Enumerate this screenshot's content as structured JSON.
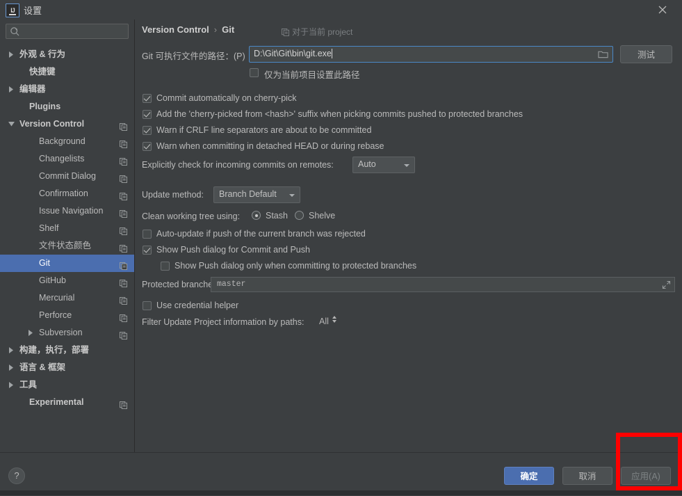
{
  "window": {
    "title": "设置",
    "logo_text": "IJ",
    "close_icon": "close-icon"
  },
  "sidebar": {
    "search": {
      "placeholder": "",
      "value": "",
      "icon": "search-icon"
    },
    "items": [
      {
        "label": "外观 & 行为",
        "arrow": "collapsed",
        "indent": 14,
        "bold": true,
        "copy": false,
        "selected": false
      },
      {
        "label": "快捷键",
        "arrow": "none",
        "indent": 28,
        "bold": true,
        "copy": false,
        "selected": false
      },
      {
        "label": "编辑器",
        "arrow": "collapsed",
        "indent": 14,
        "bold": true,
        "copy": false,
        "selected": false
      },
      {
        "label": "Plugins",
        "arrow": "none",
        "indent": 28,
        "bold": true,
        "copy": false,
        "selected": false
      },
      {
        "label": "Version Control",
        "arrow": "expanded",
        "indent": 14,
        "bold": true,
        "copy": true,
        "selected": false
      },
      {
        "label": "Background",
        "arrow": "none",
        "indent": 42,
        "bold": false,
        "copy": true,
        "selected": false
      },
      {
        "label": "Changelists",
        "arrow": "none",
        "indent": 42,
        "bold": false,
        "copy": true,
        "selected": false
      },
      {
        "label": "Commit Dialog",
        "arrow": "none",
        "indent": 42,
        "bold": false,
        "copy": true,
        "selected": false
      },
      {
        "label": "Confirmation",
        "arrow": "none",
        "indent": 42,
        "bold": false,
        "copy": true,
        "selected": false
      },
      {
        "label": "Issue Navigation",
        "arrow": "none",
        "indent": 42,
        "bold": false,
        "copy": true,
        "selected": false
      },
      {
        "label": "Shelf",
        "arrow": "none",
        "indent": 42,
        "bold": false,
        "copy": true,
        "selected": false
      },
      {
        "label": "文件状态颜色",
        "arrow": "none",
        "indent": 42,
        "bold": false,
        "copy": true,
        "selected": false
      },
      {
        "label": "Git",
        "arrow": "none",
        "indent": 42,
        "bold": false,
        "copy": true,
        "selected": true
      },
      {
        "label": "GitHub",
        "arrow": "none",
        "indent": 42,
        "bold": false,
        "copy": true,
        "selected": false
      },
      {
        "label": "Mercurial",
        "arrow": "none",
        "indent": 42,
        "bold": false,
        "copy": true,
        "selected": false
      },
      {
        "label": "Perforce",
        "arrow": "none",
        "indent": 42,
        "bold": false,
        "copy": true,
        "selected": false
      },
      {
        "label": "Subversion",
        "arrow": "collapsed",
        "indent": 42,
        "bold": false,
        "copy": true,
        "selected": false
      },
      {
        "label": "构建，执行，部署",
        "arrow": "collapsed",
        "indent": 14,
        "bold": true,
        "copy": false,
        "selected": false
      },
      {
        "label": "语言 & 框架",
        "arrow": "collapsed",
        "indent": 14,
        "bold": true,
        "copy": false,
        "selected": false
      },
      {
        "label": "工具",
        "arrow": "collapsed",
        "indent": 14,
        "bold": true,
        "copy": false,
        "selected": false
      },
      {
        "label": "Experimental",
        "arrow": "none",
        "indent": 28,
        "bold": true,
        "copy": true,
        "selected": false
      }
    ]
  },
  "main": {
    "breadcrumb_parent": "Version Control",
    "breadcrumb_sep": "›",
    "breadcrumb_current": "Git",
    "scope_label": "对于当前 project",
    "path_label": "Git 可执行文件的路径：(P)",
    "path_value": "D:\\Git\\Git\\bin\\git.exe",
    "browse_icon": "folder-icon",
    "test_button": "测试",
    "project_only_label": "仅为当前项目设置此路径",
    "project_only_checked": false,
    "checkboxes": [
      {
        "label": "Commit automatically on cherry-pick",
        "checked": true
      },
      {
        "label": "Add the 'cherry-picked from <hash>' suffix when picking commits pushed to protected branches",
        "checked": true
      },
      {
        "label": "Warn if CRLF line separators are about to be committed",
        "checked": true
      },
      {
        "label": "Warn when committing in detached HEAD or during rebase",
        "checked": true
      }
    ],
    "incoming_label": "Explicitly check for incoming commits on remotes:",
    "incoming_value": "Auto",
    "update_method_label": "Update method:",
    "update_method_value": "Branch Default",
    "clean_tree_label": "Clean working tree using:",
    "clean_stash_label": "Stash",
    "clean_shelve_label": "Shelve",
    "clean_selected": "Stash",
    "autoupdate_label": "Auto-update if push of the current branch was rejected",
    "autoupdate_checked": false,
    "showpush_label": "Show Push dialog for Commit and Push",
    "showpush_checked": true,
    "showpush_protected_label": "Show Push dialog only when committing to protected branches",
    "showpush_protected_checked": false,
    "protected_branches_label": "Protected branches:",
    "protected_branches_value": "master",
    "expand_icon": "expand-icon",
    "credential_label": "Use credential helper",
    "credential_checked": false,
    "filter_label": "Filter Update Project information by paths:",
    "filter_value": "All"
  },
  "footer": {
    "help_label": "?",
    "ok_label": "确定",
    "cancel_label": "取消",
    "apply_label": "应用(A)"
  },
  "annotation": {
    "highlight_color": "#ff0000",
    "target": "apply-button"
  },
  "colors": {
    "background": "#3c3f41",
    "selection": "#4b6eaf",
    "field": "#45494a",
    "focus_border": "#4a88c7",
    "text": "#bbbbbb"
  }
}
